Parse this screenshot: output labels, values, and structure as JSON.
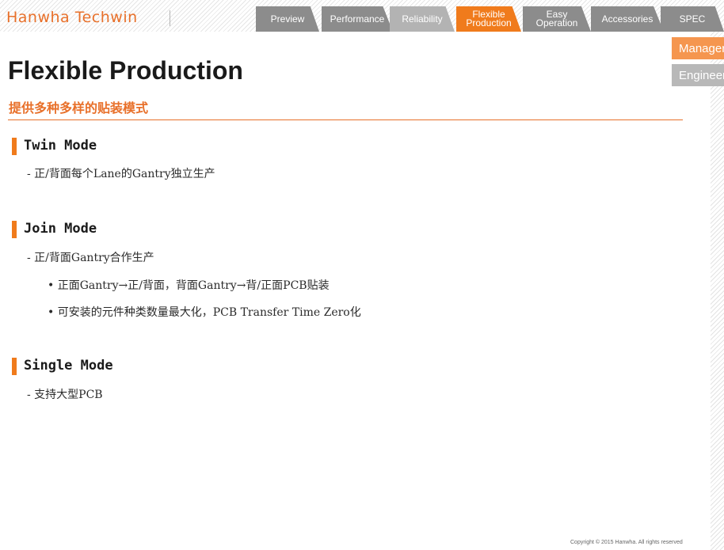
{
  "brand": {
    "logo_text": "Hanwha Techwin"
  },
  "nav": {
    "tabs": [
      {
        "label1": "Preview",
        "label2": "",
        "color": "#8c8c8c"
      },
      {
        "label1": "Performance",
        "label2": "",
        "color": "#8c8c8c"
      },
      {
        "label1": "Reliability",
        "label2": "",
        "color": "#b3b3b3"
      },
      {
        "label1": "Flexible",
        "label2": "Production",
        "color": "#f07b1c",
        "active": true
      },
      {
        "label1": "Easy",
        "label2": "Operation",
        "color": "#8c8c8c"
      },
      {
        "label1": "Accessories",
        "label2": "",
        "color": "#8c8c8c"
      },
      {
        "label1": "SPEC",
        "label2": "",
        "color": "#8c8c8c"
      }
    ]
  },
  "side_nav": {
    "items": [
      {
        "label": "Manager",
        "color": "#f5964f"
      },
      {
        "label": "Engineer",
        "color": "#b8b8b8"
      }
    ]
  },
  "page": {
    "title": "Flexible Production",
    "subtitle": "提供多种多样的贴装模式"
  },
  "sections": [
    {
      "title": "Twin Mode",
      "items": [
        "-  正/背面每个Lane的Gantry独立生产"
      ]
    },
    {
      "title": "Join Mode",
      "items": [
        "-  正/背面Gantry合作生产"
      ],
      "sub_items": [
        "•  正面Gantry→正/背面，背面Gantry→背/正面PCB贴装",
        "•  可安装的元件种类数量最大化，PCB Transfer Time Zero化"
      ]
    },
    {
      "title": "Single Mode",
      "items": [
        "-  支持大型PCB"
      ]
    }
  ],
  "footer": {
    "copyright": "Copyright © 2015 Hanwha. All rights reserved"
  }
}
